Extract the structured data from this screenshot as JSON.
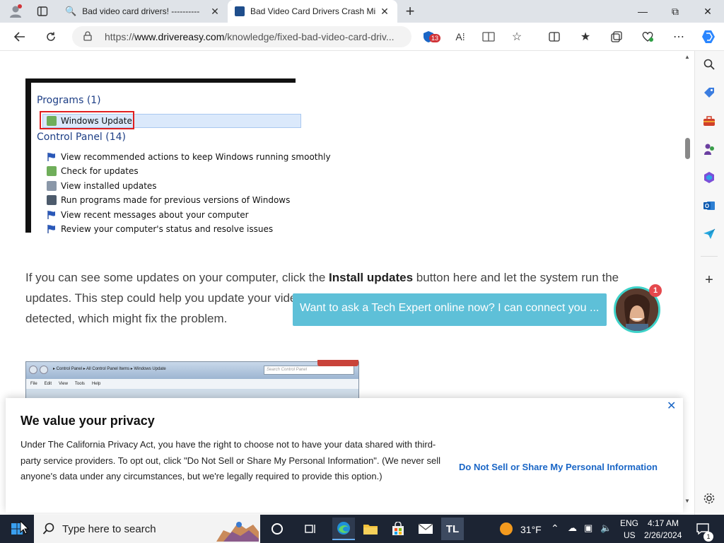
{
  "browser": {
    "tabs": [
      {
        "title": "Bad video card drivers! ----------",
        "active": false
      },
      {
        "title": "Bad Video Card Drivers Crash Mi",
        "active": true
      }
    ],
    "address": {
      "url_prefix": "https://",
      "url_domain": "www.drivereasy.com",
      "url_path": "/knowledge/fixed-bad-video-card-driv...",
      "extension_badge": "13"
    }
  },
  "page": {
    "screenshot1": {
      "programs_header": "Programs (1)",
      "programs_item": "Windows Update",
      "control_panel_header": "Control Panel (14)",
      "items": [
        "View recommended actions to keep Windows running smoothly",
        "Check for updates",
        "View installed updates",
        "Run programs made for previous versions of Windows",
        "View recent messages about your computer",
        "Review your computer's status and resolve issues"
      ]
    },
    "paragraph": {
      "text_before": "If you can see some updates on your computer, click the ",
      "bold": "Install updates",
      "text_after": " button here and let the system run the updates. This step could help you update your video card drivers or graphics card drivers, but there is update detected, which might fix the problem."
    },
    "screenshot2": {
      "breadcrumb": "▸ Control Panel ▸ All Control Panel Items ▸ Windows Update",
      "search_placeholder": "Search Control Panel",
      "menu": [
        "File",
        "Edit",
        "View",
        "Tools",
        "Help"
      ]
    },
    "chat": {
      "message": "Want to ask a Tech Expert online now? I can connect you ...",
      "notification_count": "1"
    },
    "privacy": {
      "title": "We value your privacy",
      "body": "Under The California Privacy Act, you have the right to choose not to have your data shared with third-party service providers. To opt out, click \"Do Not Sell or Share My Personal Information\". (We never sell anyone's data under any circumstances, but we're legally required to provide this option.)",
      "link": "Do Not Sell or Share My Personal Information",
      "close": "✕"
    }
  },
  "taskbar": {
    "search_placeholder": "Type here to search",
    "weather": "31°F",
    "lang_top": "ENG",
    "lang_bottom": "US",
    "time": "4:17 AM",
    "date": "2/26/2024",
    "notification_count": "1",
    "app_tl": "TL"
  },
  "colors": {
    "accent_link": "#1a66c6",
    "chat_bubble": "#5ec0d8",
    "taskbar": "#1c2433"
  }
}
